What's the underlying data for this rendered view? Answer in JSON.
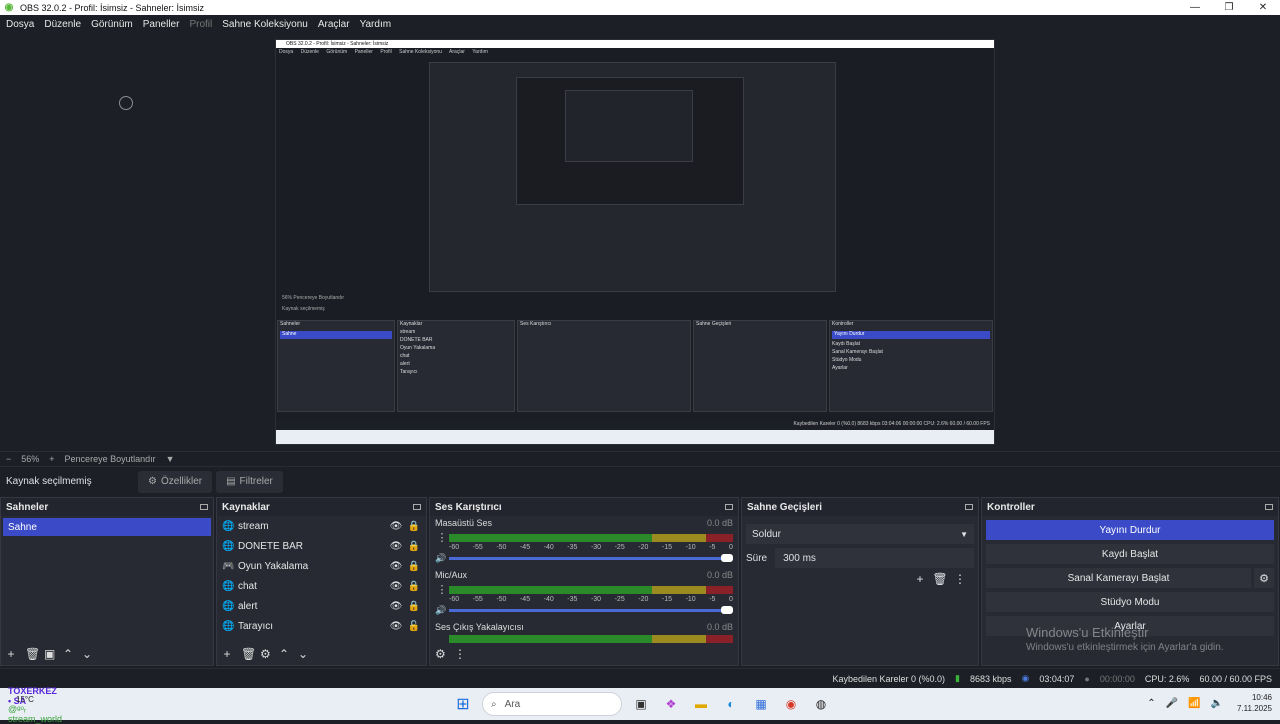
{
  "window": {
    "title": "OBS 32.0.2 - Profil: İsimsiz - Sahneler: İsimsiz",
    "min": "—",
    "max": "❐",
    "close": "✕"
  },
  "menu": [
    "Dosya",
    "Düzenle",
    "Görünüm",
    "Paneller",
    "Profil",
    "Sahne Koleksiyonu",
    "Araçlar",
    "Yardım"
  ],
  "zoombar": {
    "minus": "−",
    "zoom": "56%",
    "plus": "+",
    "fit": "Pencereye Boyutlandır",
    "arrow": "▼"
  },
  "propbar": {
    "no_selection": "Kaynak seçilmemiş",
    "properties": "Özellikler",
    "filters": "Filtreler"
  },
  "docks": {
    "scenes": {
      "title": "Sahneler",
      "items": [
        "Sahne"
      ]
    },
    "sources": {
      "title": "Kaynaklar",
      "items": [
        {
          "label": "stream",
          "icon": "globe-icon"
        },
        {
          "label": "DONETE BAR",
          "icon": "globe-icon"
        },
        {
          "label": "Oyun Yakalama",
          "icon": "gamepad-icon"
        },
        {
          "label": "chat",
          "icon": "globe-icon"
        },
        {
          "label": "alert",
          "icon": "globe-icon"
        },
        {
          "label": "Tarayıcı",
          "icon": "globe-icon"
        }
      ]
    },
    "mixer": {
      "title": "Ses Karıştırıcı",
      "channels": [
        {
          "name": "Masaüstü Ses",
          "db": "0.0 dB"
        },
        {
          "name": "Mic/Aux",
          "db": "0.0 dB"
        },
        {
          "name": "Ses Çıkış Yakalayıcısı",
          "db": "0.0 dB"
        }
      ],
      "ticks": [
        "-60",
        "-55",
        "-50",
        "-45",
        "-40",
        "-35",
        "-30",
        "-25",
        "-20",
        "-15",
        "-10",
        "-5",
        "0"
      ]
    },
    "transitions": {
      "title": "Sahne Geçişleri",
      "selected": "Soldur",
      "duration_label": "Süre",
      "duration_value": "300 ms"
    },
    "controls": {
      "title": "Kontroller",
      "stop_stream": "Yayını Durdur",
      "start_record": "Kaydı Başlat",
      "virtual_cam": "Sanal Kamerayı Başlat",
      "studio": "Stüdyo Modu",
      "settings": "Ayarlar"
    }
  },
  "watermark": {
    "line1": "Windows'u Etkinleştir",
    "line2": "Windows'u etkinleştirmek için Ayarlar'a gidin."
  },
  "status": {
    "dropped": "Kaybedilen Kareler 0 (%0.0)",
    "bitrate": "8683 kbps",
    "live_time": "03:04:07",
    "rec_time": "00:00:00",
    "cpu": "CPU: 2.6%",
    "fps": "60.00 / 60.00 FPS"
  },
  "taskbar": {
    "temp": "15°C",
    "brand": "TOXERKEZ • SA",
    "stream_text": "@ᵍᵒᵣ stream_world",
    "search_placeholder": "Ara",
    "time": "10:46",
    "date": "7.11.2025"
  },
  "nested": {
    "title": "OBS 32.0.2 - Profil: İsimsiz - Sahneler: İsimsiz",
    "menu": [
      "Dosya",
      "Düzenle",
      "Görünüm",
      "Paneller",
      "Profil",
      "Sahne Koleksiyonu",
      "Araçlar",
      "Yardım"
    ],
    "zoom": "56%   Pencereye Boyutlandır",
    "no_selection": "Kaynak seçilmemiş",
    "status": "Kaybedilen Kareler 0 (%0.0)   8683 kbps   03:04:06   00:00:00   CPU: 2.6%   60.00 / 60.00 FPS",
    "docks": [
      "Sahneler",
      "Kaynaklar",
      "Ses Karıştırıcı",
      "Sahne Geçişleri",
      "Kontroller"
    ],
    "scene": "Sahne",
    "sources": [
      "stream",
      "DONETE BAR",
      "Oyun Yakalama",
      "chat",
      "alert",
      "Tarayıcı"
    ],
    "ctrl_primary": "Yayını Durdur",
    "ctrl_items": [
      "Kaydı Başlat",
      "Sanal Kamerayı Başlat",
      "Stüdyo Modu",
      "Ayarlar"
    ]
  }
}
